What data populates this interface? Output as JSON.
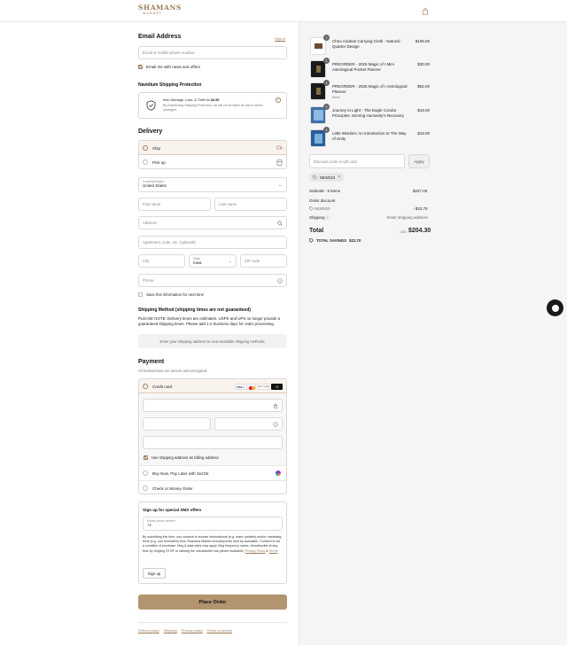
{
  "header": {
    "logo_line1": "SHAMANS",
    "logo_line2": "MARKET"
  },
  "contact": {
    "title": "Email Address",
    "signin_label": "Sign in",
    "email_placeholder": "Email or mobile phone number",
    "news_label": "Email me with news and offers"
  },
  "protection": {
    "title": "Navidium Shipping Protection",
    "line_prefix": "from Damage, Loss, & Theft for ",
    "price": "$4.50",
    "note": "By Deselecting Shipping Protection, we will not be liable for lost or stolen packages."
  },
  "delivery": {
    "title": "Delivery",
    "ship_label": "Ship",
    "pickup_label": "Pick up",
    "country_label": "Country/Region",
    "country_value": "United States",
    "first_name": "First name",
    "last_name": "Last name",
    "address": "Address",
    "apartment": "Apartment, suite, etc. (optional)",
    "city": "City",
    "state_label": "State",
    "state_value": "Iowa",
    "zip": "ZIP code",
    "phone": "Phone",
    "save_label": "Save this information for next time"
  },
  "shipping_method": {
    "title": "Shipping Method (shipping times are not guaranteed)",
    "notice": "PLEASE NOTE: Delivery times are estimates. USPS and UPS no longer provide a guaranteed shipping times. Please add 1-2 business days for order processing.",
    "placeholder": "Enter your shipping address to view available shipping methods."
  },
  "payment": {
    "title": "Payment",
    "subtitle": "All transactions are secure and encrypted.",
    "credit_card_label": "Credit card",
    "card_brands": [
      "VISA",
      "MC",
      "DISCOVER",
      "+3"
    ],
    "billing_label": "Use shipping address as billing address",
    "sezzle_label": "Buy Now, Pay Later with Sezzle",
    "check_label": "Check or Money Order"
  },
  "sms": {
    "title": "Sign up for special SMS offers",
    "phone_label": "Mobile phone number",
    "phone_prefix": "+1",
    "consent_text": "By submitting this form, you consent to receive informational (e.g. order updates) and/or marketing texts (e.g. cart reminders) from Shamans Market including texts sent by autodialer. Consent is not a condition of purchase. Msg & data rates may apply. Msg frequency varies. Unsubscribe at any time by replying STOP or clicking the unsubscribe link (where available).",
    "privacy_link": "Privacy Policy",
    "amp": "&",
    "terms_link": "Terms",
    "signup_label": "Sign up"
  },
  "place_order_label": "Place Order",
  "footer_links": [
    "Refund policy",
    "Shipping",
    "Privacy policy",
    "Terms of service"
  ],
  "cart": {
    "items": [
      {
        "qty": "1",
        "name": "Cheo Andean Carrying Cloth - Natural - Quarter Design",
        "variant": "",
        "price": "$105.00"
      },
      {
        "qty": "1",
        "name": "PREORDER - 2026 Magic of I Mini Astrological Pocket Planner",
        "variant": "",
        "price": "$30.00"
      },
      {
        "qty": "1",
        "name": "PREORDER - 2026 Magic of I Astrological Planner",
        "variant": "Black",
        "price": "$52.00"
      },
      {
        "qty": "1",
        "name": "Journey to Light - The Eagle Condor Principles: Serving Humanity's Recovery",
        "variant": "",
        "price": "$18.00"
      },
      {
        "qty": "1",
        "name": "Little Wisdom: An Introduction to The Way of Unity",
        "variant": "",
        "price": "$19.00"
      }
    ],
    "discount_placeholder": "Discount code or gift card",
    "apply_label": "Apply",
    "applied_code": "NEWS10",
    "subtotal_label": "Subtotal · 5 items",
    "subtotal_value": "$227.00",
    "order_discount_label": "Order discount",
    "discount_code": "NEWS10",
    "discount_value": "- $22.70",
    "shipping_label": "Shipping",
    "shipping_value": "Enter shipping address",
    "total_label": "Total",
    "currency": "USD",
    "total_value": "$204.30",
    "savings_label": "TOTAL SAVINGS",
    "savings_value": "$22.70"
  },
  "colors": {
    "accent": "#9b7a57",
    "button": "#b39470",
    "summary_bg": "#f5f5f5"
  }
}
